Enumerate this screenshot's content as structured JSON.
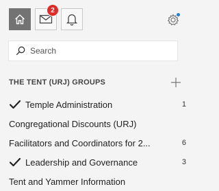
{
  "topbar": {
    "home_icon": "home-icon",
    "mail_icon": "mail-icon",
    "mail_badge": "2",
    "bell_icon": "bell-icon",
    "settings_icon": "gear-icon",
    "active_color": "#737373",
    "badge_color": "#e02b2b",
    "settings_dot_color": "#2a7bd4"
  },
  "search": {
    "placeholder": "Search"
  },
  "groups_section": {
    "title": "THE TENT (URJ) GROUPS",
    "add_icon": "plus-icon",
    "items": [
      {
        "label": "Temple Administration",
        "checked": true,
        "count": "1"
      },
      {
        "label": "Congregational Discounts (URJ)",
        "checked": false,
        "count": ""
      },
      {
        "label": "Facilitators and Coordinators for 2...",
        "checked": false,
        "count": "6"
      },
      {
        "label": "Leadership and Governance",
        "checked": true,
        "count": "3"
      },
      {
        "label": "Tent and Yammer Information",
        "checked": false,
        "count": ""
      }
    ]
  }
}
